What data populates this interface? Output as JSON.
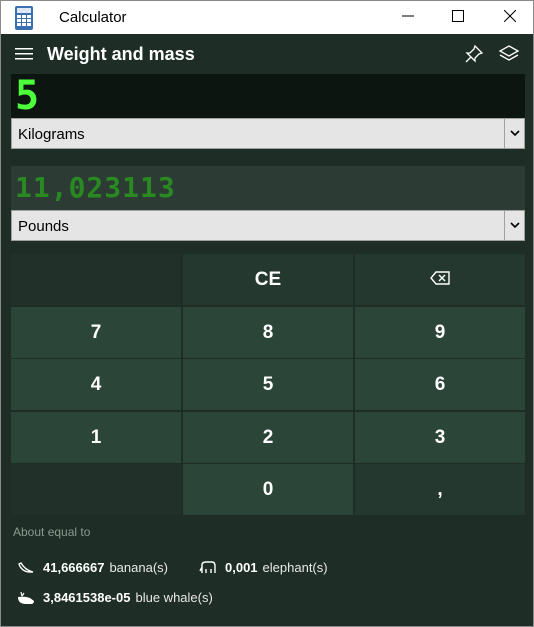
{
  "window": {
    "title": "Calculator",
    "icons": [
      "calculator-app-icon",
      "minimize-icon",
      "maximize-icon",
      "close-icon"
    ]
  },
  "header": {
    "mode_title": "Weight and mass",
    "icons": [
      "hamburger-icon",
      "pin-icon",
      "layers-icon"
    ]
  },
  "converter": {
    "input_value": "5",
    "from_unit": "Kilograms",
    "output_value": "11,023113",
    "to_unit": "Pounds"
  },
  "keypad": {
    "ce": "CE",
    "backspace_icon": "backspace-icon",
    "k7": "7",
    "k8": "8",
    "k9": "9",
    "k4": "4",
    "k5": "5",
    "k6": "6",
    "k1": "1",
    "k2": "2",
    "k3": "3",
    "k0": "0",
    "decimal": ","
  },
  "about": {
    "label": "About equal to",
    "items": [
      {
        "value": "41,666667",
        "unit": "banana(s)",
        "icon": "banana-icon"
      },
      {
        "value": "0,001",
        "unit": "elephant(s)",
        "icon": "elephant-icon"
      },
      {
        "value": "3,8461538e-05",
        "unit": "blue whale(s)",
        "icon": "whale-icon"
      }
    ]
  },
  "colors": {
    "background": "#1e2e26",
    "key": "#2c4539",
    "input_text": "#4cff3a",
    "output_text": "#2a8a22"
  }
}
